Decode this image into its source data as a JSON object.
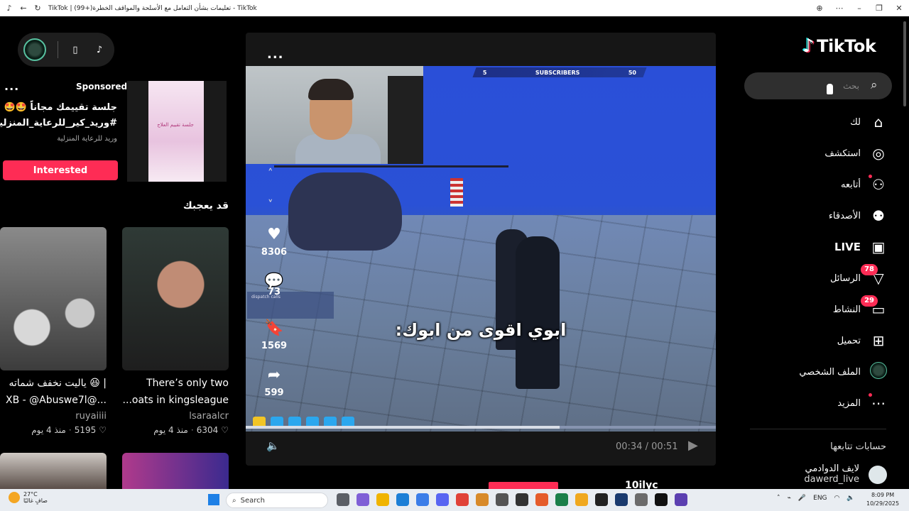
{
  "browser": {
    "title": "TikTok | تعليمات بشأن التعامل مع الأسلحة والمواقف الخطرة(+99) - TikTok",
    "icons": [
      "tiktok-tab-icon",
      "back-arrow-icon",
      "reload-icon",
      "zoom-icon",
      "more-icon",
      "minimize-icon",
      "restore-icon",
      "close-icon"
    ]
  },
  "ad": {
    "sponsored": "Sponsored",
    "line1": "جلسة تقييمك مجاناً 🤩🤩",
    "line2": "#وريد_كير_للرعاية_المنزلية...",
    "advertiser": "وريد للرعاية المنزلية",
    "button": "Interested",
    "thumb_text": "جلسة تقييم العلاج",
    "more": "..."
  },
  "may_like": {
    "title": "قد يعجبك",
    "cards": [
      {
        "title1": "ياليت نخفف شماته 😆 |",
        "title2": "XB - @Abuswe7l@...",
        "user": "ruyaiiii",
        "likes": "5195",
        "age": "منذ 4 يوم"
      },
      {
        "title1": "There’s only two",
        "title2": "...oats in kingsleague",
        "user": "lsaraalcr",
        "likes": "6304",
        "age": "منذ 4 يوم"
      }
    ]
  },
  "video": {
    "more": "...",
    "subscribers_label": "SUBSCRIBERS",
    "subscribers_left": "5",
    "subscribers_right": "50",
    "dispatch": "dispatch calls",
    "subtitle": "ابوي اقوى من ابوك:",
    "progress": 0.667,
    "time": "00:34 / 00:51",
    "next_user": "10ilyc",
    "actions": [
      {
        "name": "like",
        "icon": "♥",
        "count": "8306"
      },
      {
        "name": "comment",
        "icon": "💬",
        "count": "73"
      },
      {
        "name": "save",
        "icon": "🔖",
        "count": "1569"
      },
      {
        "name": "share",
        "icon": "➦",
        "count": "599"
      }
    ]
  },
  "nav": {
    "logo": "TikTok",
    "search_placeholder": "بحث",
    "items": [
      {
        "label": "لك",
        "icon": "⌂"
      },
      {
        "label": "استكشف",
        "icon": "◎"
      },
      {
        "label": "أتابعه",
        "icon": "⚇"
      },
      {
        "label": "الأصدقاء",
        "icon": "⚉"
      },
      {
        "label": "LIVE",
        "icon": "▣"
      },
      {
        "label": "الرسائل",
        "icon": "▽",
        "badge": "78"
      },
      {
        "label": "النشاط",
        "icon": "▭",
        "badge": "29"
      },
      {
        "label": "تحميل",
        "icon": "⊞"
      },
      {
        "label": "الملف الشخصي",
        "icon": "avatar"
      },
      {
        "label": "المزيد",
        "icon": "⋯"
      }
    ],
    "following_title": "حسابات تتابعها",
    "following": [
      {
        "name": "لايف الدوادمي",
        "handle": "dawerd_live"
      }
    ]
  },
  "taskbar": {
    "temp": "27°C",
    "weather": "صافٍ غالبًا",
    "search": "Search",
    "lang": "ENG",
    "time": "8:09 PM",
    "date": "10/29/2025",
    "app_colors": [
      "#5b5f66",
      "#7f5fd6",
      "#f0b400",
      "#1d7fd6",
      "#3b7de8",
      "#5865f2",
      "#e04238",
      "#d88a2a",
      "#555555",
      "#333333",
      "#e55c2b",
      "#1b7f4a",
      "#f0a81f",
      "#222222",
      "#1a3a6e",
      "#6b6b6b",
      "#111111",
      "#5b3fb0"
    ]
  }
}
